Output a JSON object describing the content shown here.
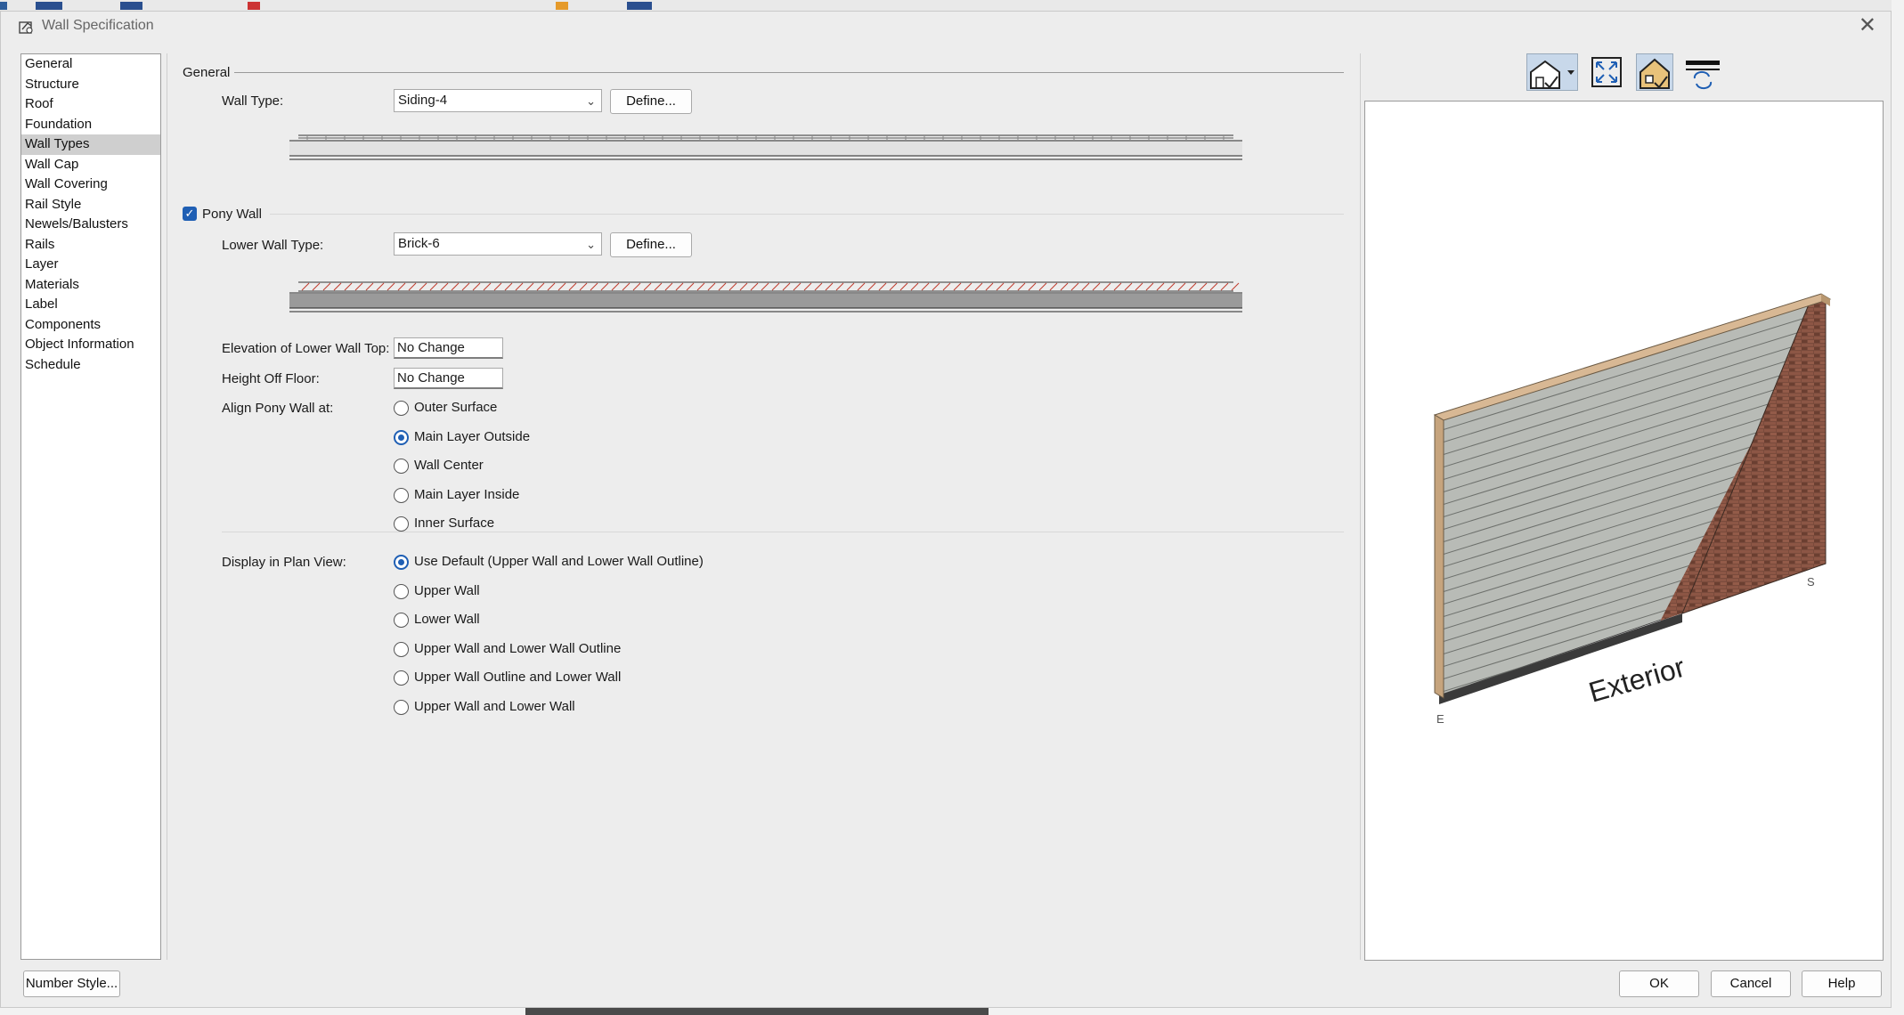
{
  "window": {
    "title": "Wall Specification",
    "close_glyph": "✕"
  },
  "nav": {
    "items": [
      "General",
      "Structure",
      "Roof",
      "Foundation",
      "Wall Types",
      "Wall Cap",
      "Wall Covering",
      "Rail Style",
      "Newels/Balusters",
      "Rails",
      "Layer",
      "Materials",
      "Label",
      "Components",
      "Object Information",
      "Schedule"
    ],
    "selected": "Wall Types"
  },
  "general": {
    "heading": "General",
    "wall_type_label": "Wall Type:",
    "wall_type_value": "Siding-4",
    "define_label": "Define..."
  },
  "pony_wall": {
    "checkbox_label": "Pony Wall",
    "checked": true,
    "lower_wall_type_label": "Lower Wall Type:",
    "lower_wall_type_value": "Brick-6",
    "define_label": "Define...",
    "elevation_label": "Elevation of Lower Wall Top:",
    "elevation_value": "No Change",
    "height_label": "Height Off Floor:",
    "height_value": "No Change",
    "align_label": "Align Pony Wall at:",
    "align_options": [
      "Outer Surface",
      "Main Layer Outside",
      "Wall Center",
      "Main Layer Inside",
      "Inner Surface"
    ],
    "align_selected": "Main Layer Outside",
    "display_label": "Display in Plan View:",
    "display_options": [
      "Use Default (Upper Wall and Lower Wall Outline)",
      "Upper Wall",
      "Lower Wall",
      "Upper Wall and Lower Wall Outline",
      "Upper Wall Outline and Lower Wall",
      "Upper Wall and Lower Wall"
    ],
    "display_selected": "Use Default (Upper Wall and Lower Wall Outline)"
  },
  "preview": {
    "toolbar_icons": [
      "house-view-icon",
      "fit-view-icon",
      "materials-toggle-icon",
      "wall-layer-refresh-icon"
    ],
    "exterior_label": "Exterior",
    "corner_e": "E",
    "corner_s": "S",
    "colors": {
      "siding": "#b8bbb6",
      "brick": "#7a4b3c",
      "cap": "#d8b894"
    }
  },
  "footer": {
    "number_style": "Number Style...",
    "ok": "OK",
    "cancel": "Cancel",
    "help": "Help"
  }
}
